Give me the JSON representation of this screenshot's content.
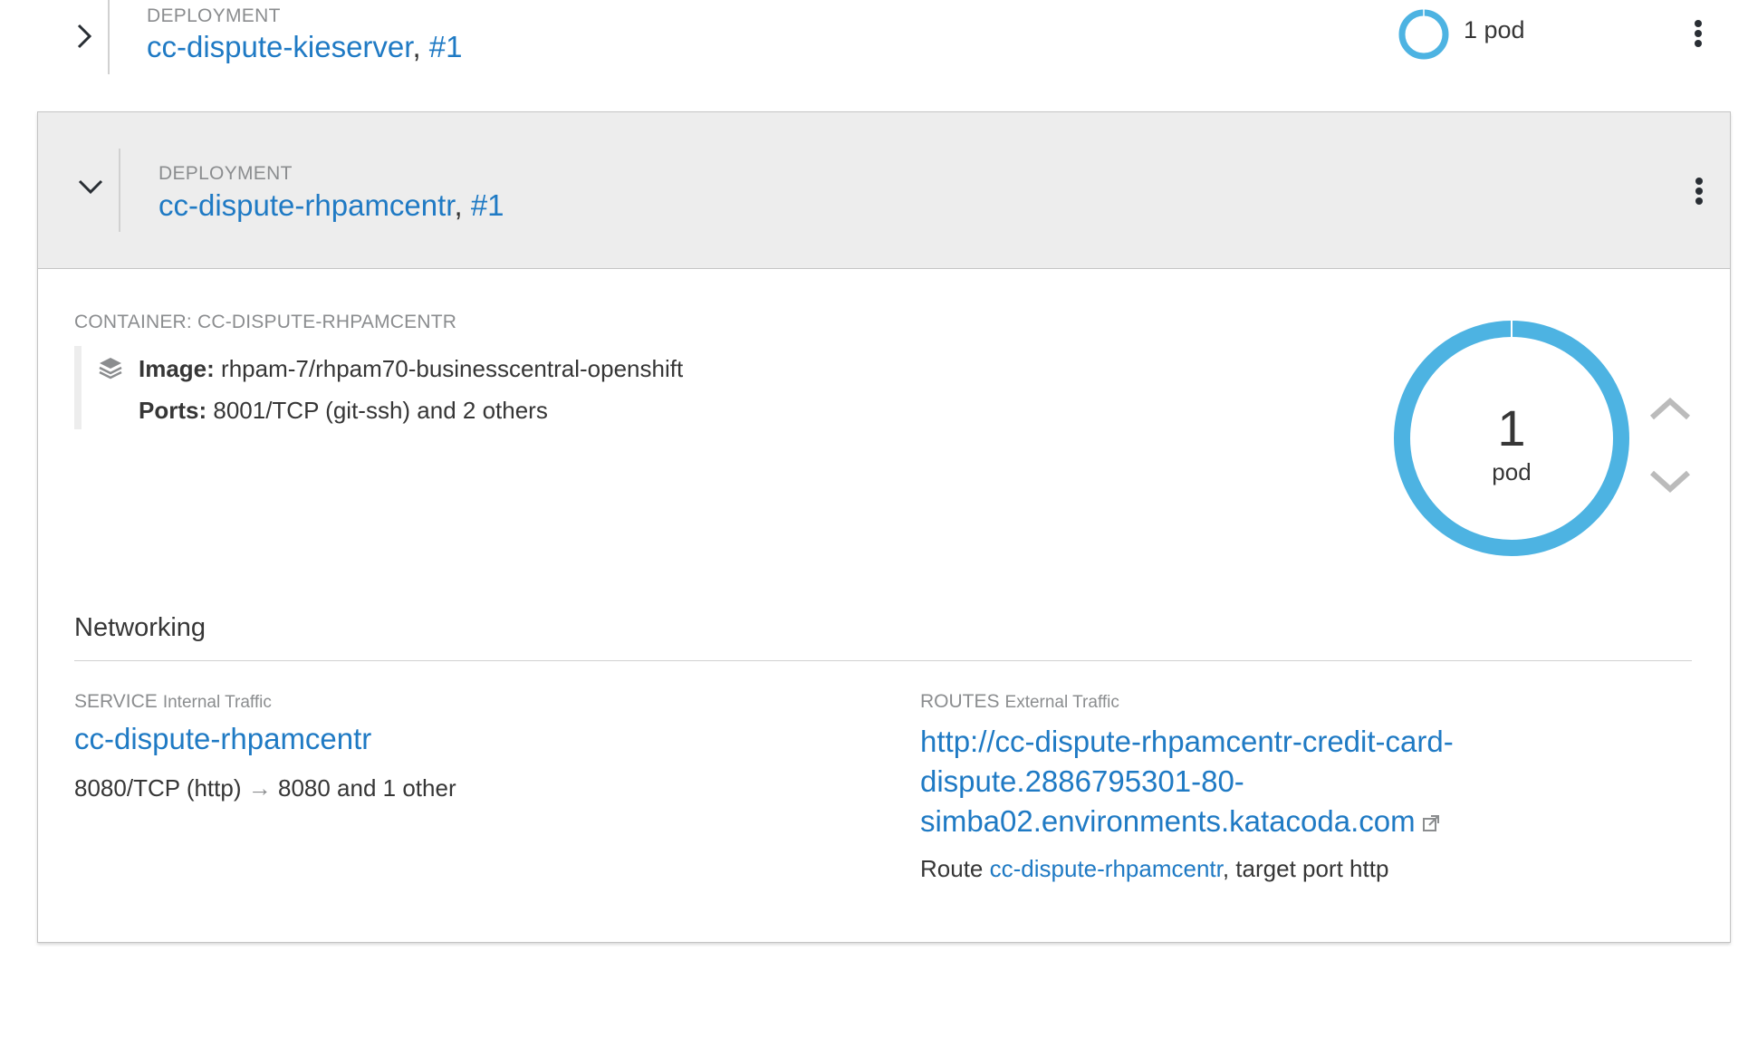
{
  "deployments": [
    {
      "label": "DEPLOYMENT",
      "name": "cc-dispute-kieserver",
      "separator": ",",
      "revision": "#1",
      "pods_text": "1 pod",
      "expanded": false
    },
    {
      "label": "DEPLOYMENT",
      "name": "cc-dispute-rhpamcentr",
      "separator": ",",
      "revision": "#1",
      "expanded": true,
      "container": {
        "label": "CONTAINER: CC-DISPUTE-RHPAMCENTR",
        "image_key": "Image:",
        "image_value": "rhpam-7/rhpam70-businesscentral-openshift",
        "ports_key": "Ports:",
        "ports_value": "8001/TCP (git-ssh) and 2 others"
      },
      "pods": {
        "count": "1",
        "unit": "pod"
      },
      "networking": {
        "title": "Networking",
        "service": {
          "label": "SERVICE",
          "sublabel": "Internal Traffic",
          "name": "cc-dispute-rhpamcentr",
          "ports_left": "8080/TCP (http)",
          "arrow": "→",
          "ports_right": "8080 and 1 other"
        },
        "routes": {
          "label": "ROUTES",
          "sublabel": "External Traffic",
          "url": "http://cc-dispute-rhpamcentr-credit-card-dispute.2886795301-80-simba02.environments.katacoda.com",
          "route_prefix": "Route",
          "route_name": "cc-dispute-rhpamcentr",
          "route_suffix": ", target port http"
        }
      }
    }
  ],
  "colors": {
    "link": "#1f7ac4",
    "donut": "#4db3e2",
    "header_bg": "#ededed"
  },
  "icons": [
    "chevron-right-icon",
    "chevron-down-icon",
    "kebab-icon",
    "layers-icon",
    "chevron-up-icon",
    "external-link-icon"
  ]
}
